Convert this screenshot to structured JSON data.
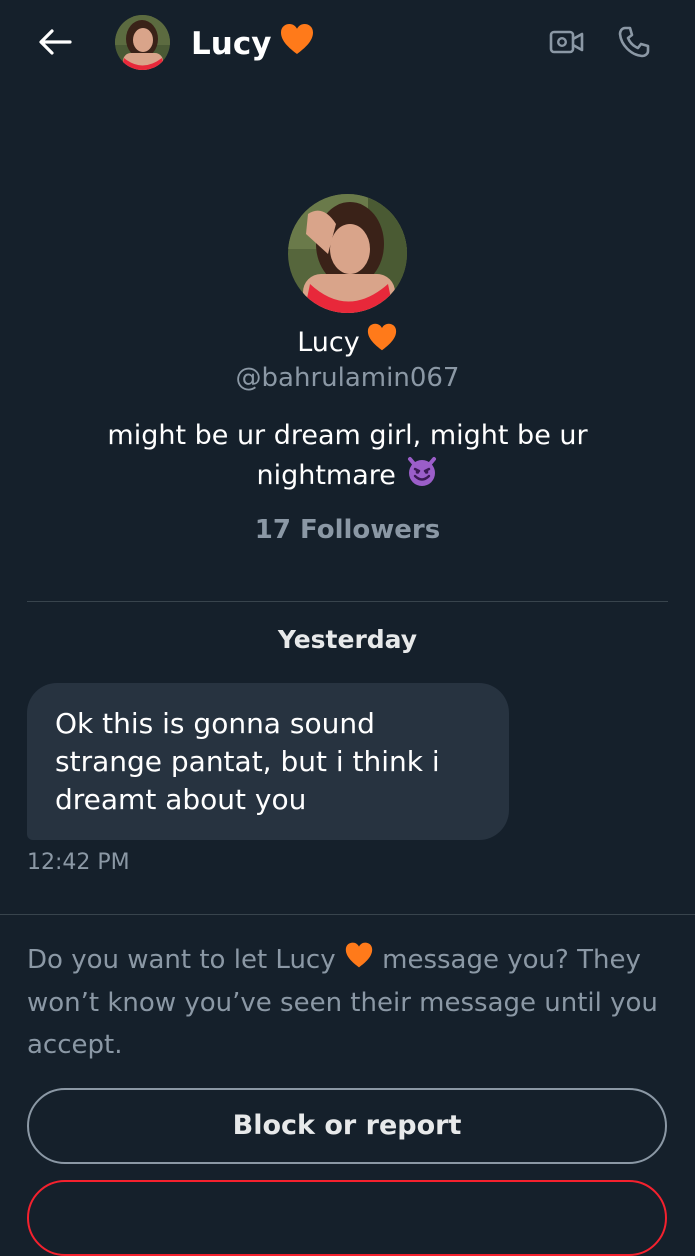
{
  "header": {
    "name": "Lucy",
    "name_emoji": "orange-heart-icon"
  },
  "profile": {
    "name": "Lucy",
    "handle": "@bahrulamin067",
    "bio": "might be ur dream girl, might be ur nightmare",
    "bio_emoji": "smiling-imp-icon",
    "followers": "17 Followers"
  },
  "conversation": {
    "date_separator": "Yesterday",
    "messages": [
      {
        "text": "Ok this is gonna sound strange pantat, but i think i dreamt about you",
        "time": "12:42 PM"
      }
    ]
  },
  "request": {
    "prompt_before": "Do you want to let Lucy",
    "prompt_after": "message you? They won’t know you’ve seen their message until you accept.",
    "block_label": "Block or report"
  },
  "colors": {
    "background": "#15202b",
    "bubble": "#273340",
    "secondary_text": "#8b98a5",
    "divider": "#38444d",
    "heart": "#ff7a1a",
    "danger": "#f4212e"
  }
}
